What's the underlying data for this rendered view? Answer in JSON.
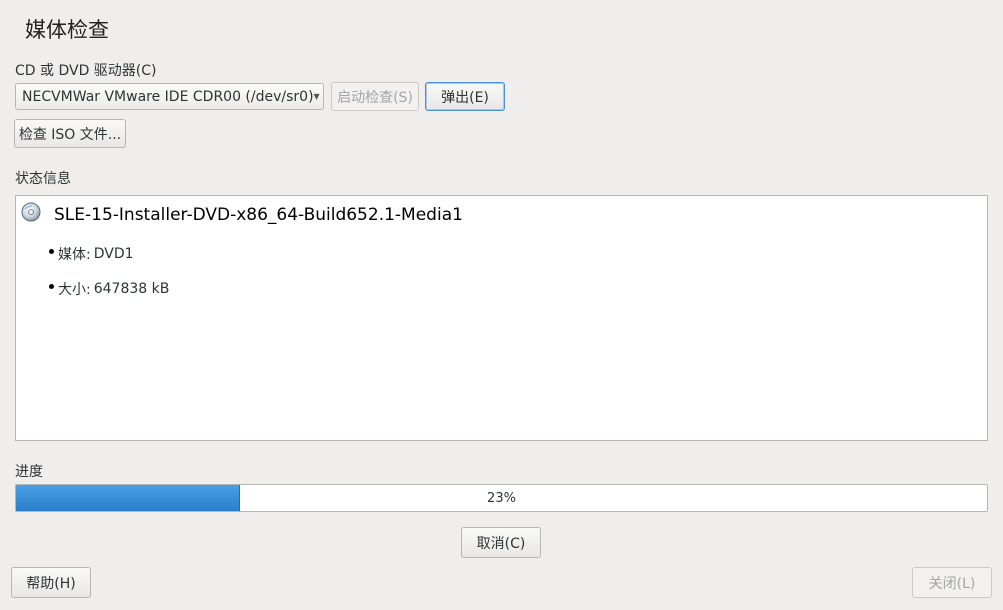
{
  "dialog": {
    "title": "媒体检查"
  },
  "drive": {
    "label": "CD 或 DVD 驱动器(C)",
    "selected": "NECVMWar VMware IDE CDR00 (/dev/sr0)",
    "start_check_label": "启动检查(S)",
    "eject_label": "弹出(E)",
    "check_iso_label": "检查 ISO 文件..."
  },
  "status": {
    "section_label": "状态信息",
    "icon": "disc-icon",
    "media_title": "SLE-15-Installer-DVD-x86_64-Build652.1-Media1",
    "items": [
      {
        "label": "媒体:",
        "value": "DVD1"
      },
      {
        "label": "大小:",
        "value": "647838 kB"
      }
    ]
  },
  "progress": {
    "section_label": "进度",
    "percent": 23,
    "percent_text": "23%",
    "fill_color": "#3a8fdb"
  },
  "buttons": {
    "cancel_label": "取消(C)",
    "help_label": "帮助(H)",
    "close_label": "关闭(L)"
  }
}
